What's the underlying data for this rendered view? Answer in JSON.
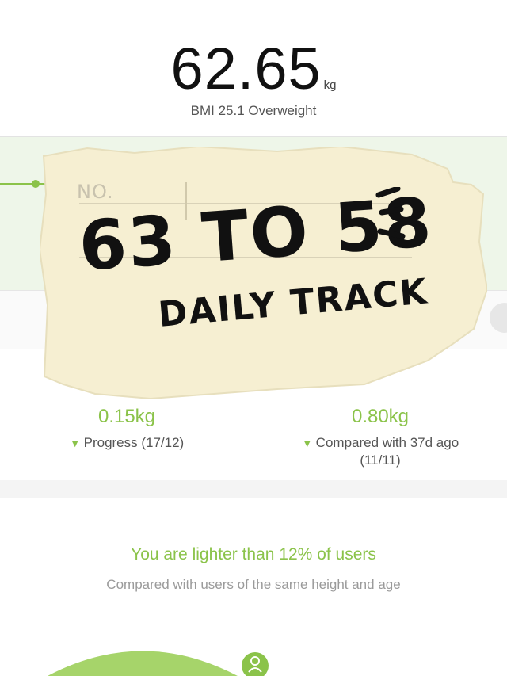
{
  "header": {
    "weight": "62.65",
    "unit": "kg",
    "bmi": "BMI 25.1 Overweight"
  },
  "stats": [
    {
      "value": "0.15kg",
      "label": "Progress (17/12)"
    },
    {
      "value": "0.80kg",
      "label": "Compared with 37d ago",
      "label2": "(11/11)"
    }
  ],
  "ranking": {
    "headline": "You are lighter than 12% of users",
    "subtext": "Compared with users of the same height and age"
  },
  "note": {
    "no_label": "NO.",
    "title": "63 TO 58",
    "subtitle": "DAILY TRACK"
  },
  "colors": {
    "accent": "#8bc34a",
    "paper": "#f6efd2",
    "ink": "#111111"
  },
  "icons": [
    "user-icon",
    "sparkle-marks"
  ]
}
